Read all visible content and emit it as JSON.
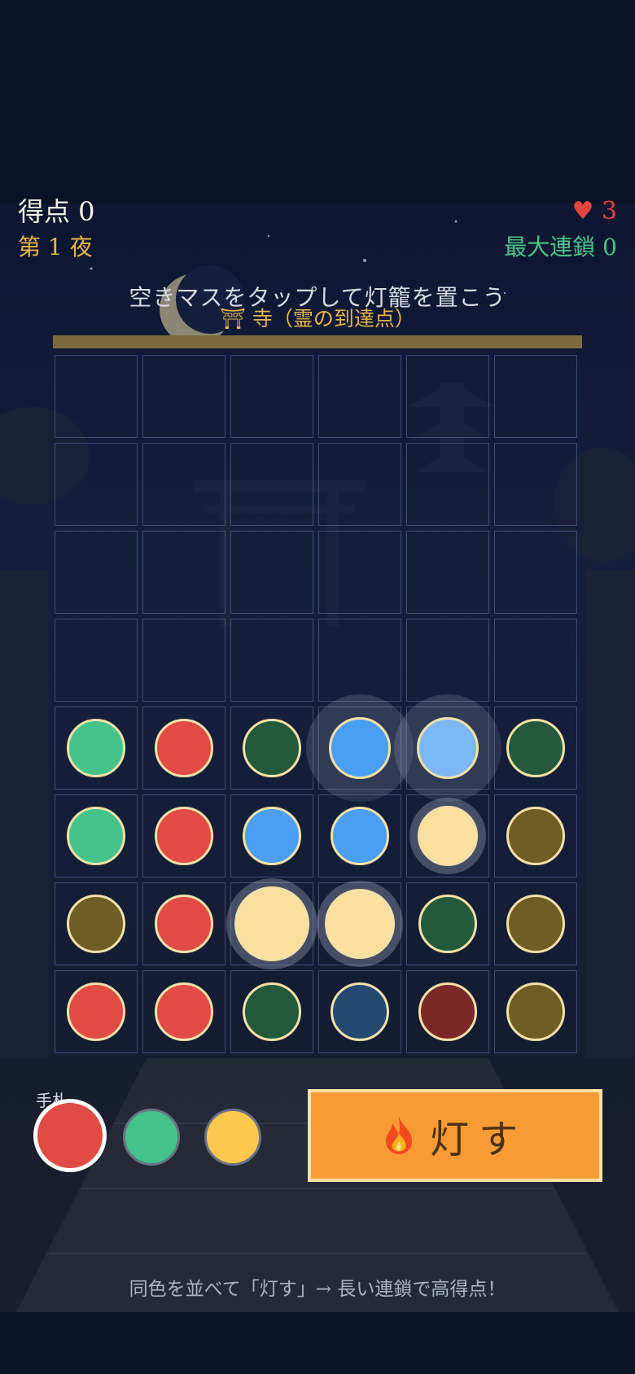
{
  "hud": {
    "score_label": "得点 0",
    "night_label": "第 1 夜",
    "lives_label": "♥ 3",
    "max_chain_label": "最大連鎖 0"
  },
  "instructions": {
    "hint": "空きマスをタップして灯籠を置こう",
    "goal": "⛩ 寺（霊の到達点）"
  },
  "palette": {
    "green": "#44c48a",
    "red": "#e24a44",
    "dark_green": "#245a3c",
    "blue": "#4a9ff5",
    "light_blue": "#7cb8f7",
    "cream": "#fde0a0",
    "olive": "#6e5e26",
    "navy": "#244a72",
    "maroon": "#7c2828",
    "yellow": "#fbc94e",
    "button": "#f99b35"
  },
  "board": {
    "columns": 6,
    "rows": [
      [
        null,
        null,
        null,
        null,
        null,
        null
      ],
      [
        null,
        null,
        null,
        null,
        null,
        null
      ],
      [
        null,
        null,
        null,
        null,
        null,
        null
      ],
      [
        null,
        null,
        null,
        null,
        null,
        null
      ],
      [
        "green",
        "red",
        "dark_green",
        "blue",
        "light_blue",
        "dark_green"
      ],
      [
        "green",
        "red",
        "blue",
        "blue",
        "cream",
        "olive"
      ],
      [
        "olive",
        "red",
        "cream",
        "cream",
        "dark_green",
        "olive"
      ],
      [
        "red",
        "red",
        "dark_green",
        "navy",
        "maroon",
        "olive"
      ]
    ]
  },
  "hand": {
    "label": "手札",
    "lanterns": [
      "red",
      "green",
      "yellow"
    ],
    "selected_index": 0
  },
  "light_button": {
    "label": "灯す",
    "icon": "fire-icon"
  },
  "footer": "同色を並べて「灯す」→ 長い連鎖で高得点！"
}
